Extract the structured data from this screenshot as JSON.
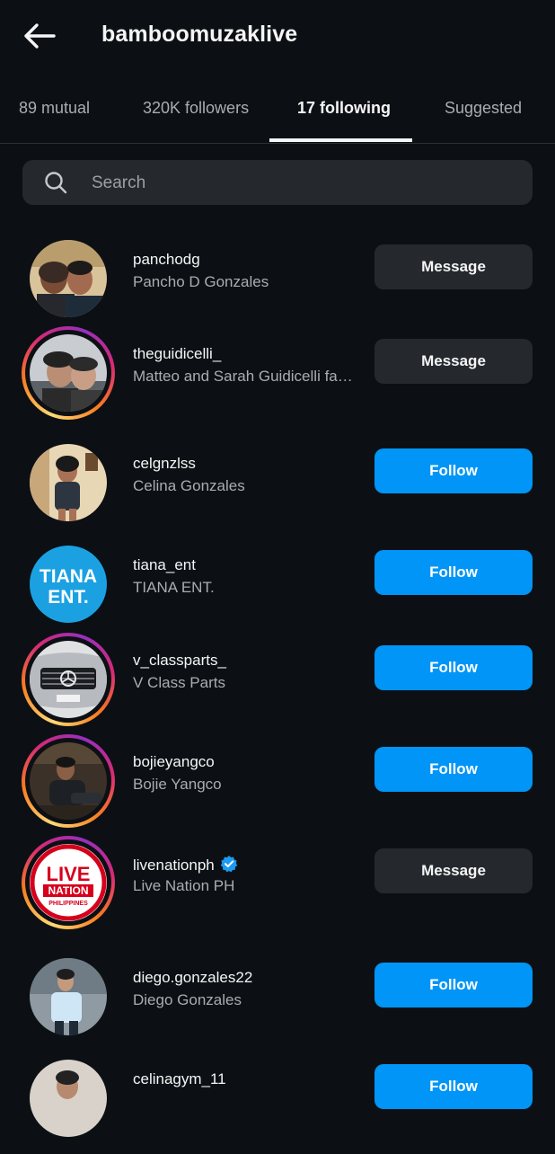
{
  "header": {
    "title": "bamboomuzaklive"
  },
  "tabs": [
    {
      "label": "89 mutual"
    },
    {
      "label": "320K followers"
    },
    {
      "label": "17 following"
    },
    {
      "label": "Suggested"
    }
  ],
  "search": {
    "placeholder": "Search"
  },
  "buttons": {
    "message": "Message",
    "follow": "Follow"
  },
  "accent": "#0095f6",
  "accounts": [
    {
      "username": "panchodg",
      "name": "Pancho D Gonzales",
      "button": "Message",
      "story_ring": false
    },
    {
      "username": "theguidicelli_",
      "name": "Matteo and Sarah Guidicelli fa…",
      "button": "Message",
      "story_ring": true
    },
    {
      "username": "celgnzlss",
      "name": "Celina Gonzales",
      "button": "Follow",
      "story_ring": false
    },
    {
      "username": "tiana_ent",
      "name": "TIANA ENT.",
      "button": "Follow",
      "story_ring": false,
      "logo_text": [
        "TIANA",
        "ENT."
      ]
    },
    {
      "username": "v_classparts_",
      "name": "V Class Parts",
      "button": "Follow",
      "story_ring": true
    },
    {
      "username": "bojieyangco",
      "name": "Bojie Yangco",
      "button": "Follow",
      "story_ring": true
    },
    {
      "username": "livenationph",
      "name": "Live Nation PH",
      "button": "Message",
      "story_ring": true,
      "verified": true,
      "logo_text": [
        "LIVE",
        "NATION",
        "PHILIPPINES"
      ]
    },
    {
      "username": "diego.gonzales22",
      "name": "Diego Gonzales",
      "button": "Follow",
      "story_ring": false
    },
    {
      "username": "celinagym_11",
      "name": "",
      "button": "Follow",
      "story_ring": false
    }
  ]
}
